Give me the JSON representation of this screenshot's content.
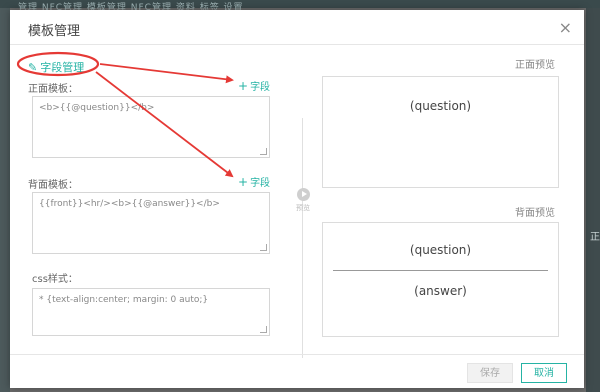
{
  "background": {
    "top_text": "管理  NFC管理  模板管理  NFC管理  资料  标签  设置",
    "side_text": "正"
  },
  "dialog": {
    "title": "模板管理",
    "close_glyph": "×"
  },
  "field_manager": {
    "icon_glyph": "✎",
    "label": "字段管理"
  },
  "front": {
    "label": "正面模板：",
    "add_label": "字段",
    "add_glyph": "+",
    "template": "<b>{{@question}}</b>"
  },
  "back": {
    "label": "背面模板：",
    "add_label": "字段",
    "add_glyph": "+",
    "template": "{{front}}<hr/><b>{{@answer}}</b>"
  },
  "css": {
    "label": "css样式：",
    "value": "* {text-align:center; margin: 0 auto;}"
  },
  "preview_toggle": {
    "label": "预览"
  },
  "front_preview": {
    "label": "正面预览",
    "text": "(question)"
  },
  "back_preview": {
    "label": "背面预览",
    "question": "(question)",
    "answer": "(answer)"
  },
  "buttons": {
    "save": "保存",
    "cancel": "取消"
  },
  "colors": {
    "accent": "#25b3a4",
    "annotation": "#e53935"
  }
}
